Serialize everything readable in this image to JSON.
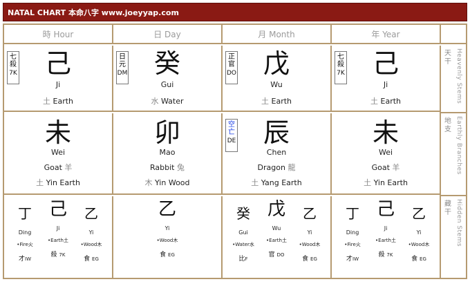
{
  "title": "NATAL CHART 本命八字 www.joeyyap.com",
  "columns": [
    {
      "header": "時 Hour",
      "stem": {
        "badge_cn": [
          "七",
          "殺"
        ],
        "badge_code": "7K",
        "char": "己",
        "pinyin": "Ji",
        "element_cn": "土",
        "element": "Earth"
      },
      "branch": {
        "char": "未",
        "pinyin": "Wei",
        "animal": "Goat",
        "animal_cn": "羊",
        "element_cn": "土",
        "element": "Yin Earth"
      },
      "hidden": [
        {
          "char": "丁",
          "pinyin": "Ding",
          "element": "•Fire火",
          "god_cn": "才",
          "god_code": "IW"
        },
        {
          "char": "己",
          "pinyin": "Ji",
          "element": "•Earth土",
          "god_cn": "殺",
          "god_code": "7K"
        },
        {
          "char": "乙",
          "pinyin": "Yi",
          "element": "•Wood木",
          "god_cn": "食",
          "god_code": "EG"
        }
      ]
    },
    {
      "header": "日 Day",
      "stem": {
        "badge_cn": [
          "日",
          "元"
        ],
        "badge_code": "DM",
        "char": "癸",
        "pinyin": "Gui",
        "element_cn": "水",
        "element": "Water"
      },
      "branch": {
        "char": "卯",
        "pinyin": "Mao",
        "animal": "Rabbit",
        "animal_cn": "兔",
        "element_cn": "木",
        "element": "Yin Wood"
      },
      "hidden": [
        {
          "char": "乙",
          "pinyin": "Yi",
          "element": "•Wood木",
          "god_cn": "食",
          "god_code": "EG"
        }
      ]
    },
    {
      "header": "月 Month",
      "stem": {
        "badge_cn": [
          "正",
          "官"
        ],
        "badge_code": "DO",
        "char": "戊",
        "pinyin": "Wu",
        "element_cn": "土",
        "element": "Earth"
      },
      "branch": {
        "badge_cn": [
          "空",
          "亡"
        ],
        "badge_code": "DE",
        "char": "辰",
        "pinyin": "Chen",
        "animal": "Dragon",
        "animal_cn": "龍",
        "element_cn": "土",
        "element": "Yang Earth"
      },
      "hidden": [
        {
          "char": "癸",
          "pinyin": "Gui",
          "element": "•Water水",
          "god_cn": "比",
          "god_code": "F"
        },
        {
          "char": "戊",
          "pinyin": "Wu",
          "element": "•Earth土",
          "god_cn": "官",
          "god_code": "DO"
        },
        {
          "char": "乙",
          "pinyin": "Yi",
          "element": "•Wood木",
          "god_cn": "食",
          "god_code": "EG"
        }
      ]
    },
    {
      "header": "年 Year",
      "stem": {
        "badge_cn": [
          "七",
          "殺"
        ],
        "badge_code": "7K",
        "char": "己",
        "pinyin": "Ji",
        "element_cn": "土",
        "element": "Earth"
      },
      "branch": {
        "char": "未",
        "pinyin": "Wei",
        "animal": "Goat",
        "animal_cn": "羊",
        "element_cn": "土",
        "element": "Yin Earth"
      },
      "hidden": [
        {
          "char": "丁",
          "pinyin": "Ding",
          "element": "•Fire火",
          "god_cn": "才",
          "god_code": "IW"
        },
        {
          "char": "己",
          "pinyin": "Ji",
          "element": "•Earth土",
          "god_cn": "殺",
          "god_code": "7K"
        },
        {
          "char": "乙",
          "pinyin": "Yi",
          "element": "•Wood木",
          "god_cn": "食",
          "god_code": "EG"
        }
      ]
    }
  ],
  "side_labels": [
    {
      "cn": "天干",
      "en": "Heavenly Stems"
    },
    {
      "cn": "地支",
      "en": "Earthly Branches"
    },
    {
      "cn": "藏干",
      "en": "Hidden Stems"
    }
  ],
  "colors": {
    "title_bg": "#8a1a14",
    "border": "#b59a70",
    "badge_blue": "#1a3ee6"
  }
}
